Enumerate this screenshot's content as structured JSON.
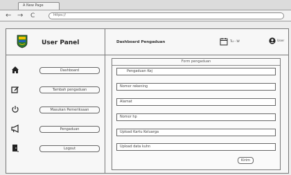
{
  "browser": {
    "tab_title": "A New Page",
    "back_glyph": "←",
    "forward_glyph": "→",
    "reload_glyph": "C",
    "address": "https://"
  },
  "sidebar": {
    "title": "User Panel",
    "items": [
      {
        "label": "Dashboard",
        "icon": "home-icon"
      },
      {
        "label": "Tambah pengaduan",
        "icon": "edit-icon"
      },
      {
        "label": "Masukan Pemeriksaan",
        "icon": "power-icon"
      },
      {
        "label": "Pengaduan",
        "icon": "megaphone-icon"
      },
      {
        "label": "Logout",
        "icon": "door-icon"
      }
    ]
  },
  "header": {
    "title": "Dashboard Pengaduan",
    "date": "Tu - W",
    "user": "User"
  },
  "form": {
    "title": "Form pengaduan",
    "fields": [
      {
        "label": "Pengaduan Kej",
        "kind": "select"
      },
      {
        "label": "Nomor rekening",
        "kind": "text"
      },
      {
        "label": "Alamat",
        "kind": "text"
      },
      {
        "label": "Nomor hp",
        "kind": "text"
      },
      {
        "label": "Upload Kartu Keluarga",
        "kind": "text"
      },
      {
        "label": "Upload data kuhn",
        "kind": "text"
      }
    ],
    "submit_label": "Kirim"
  },
  "colors": {
    "background": "#ececec",
    "panel": "#f7f7f7",
    "border": "#777777"
  }
}
